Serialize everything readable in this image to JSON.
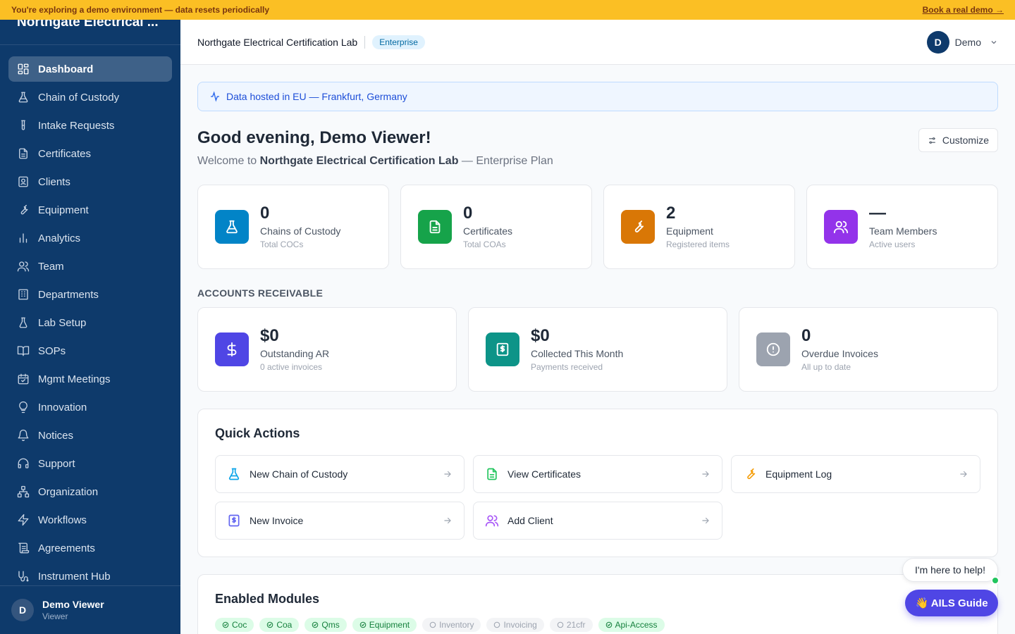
{
  "banner": {
    "text": "You're exploring a demo environment — data resets periodically",
    "link": "Book a real demo →"
  },
  "sidebar": {
    "brand": "Northgate Electrical ...",
    "items": [
      {
        "label": "Dashboard",
        "icon": "dashboard-icon",
        "active": true
      },
      {
        "label": "Chain of Custody",
        "icon": "flask-icon"
      },
      {
        "label": "Intake Requests",
        "icon": "test-tube-icon"
      },
      {
        "label": "Certificates",
        "icon": "document-icon"
      },
      {
        "label": "Clients",
        "icon": "contact-icon"
      },
      {
        "label": "Equipment",
        "icon": "wrench-icon"
      },
      {
        "label": "Analytics",
        "icon": "bar-chart-icon"
      },
      {
        "label": "Team",
        "icon": "users-icon"
      },
      {
        "label": "Departments",
        "icon": "building-icon"
      },
      {
        "label": "Lab Setup",
        "icon": "beaker-icon"
      },
      {
        "label": "SOPs",
        "icon": "book-icon"
      },
      {
        "label": "Mgmt Meetings",
        "icon": "calendar-icon"
      },
      {
        "label": "Innovation",
        "icon": "lightbulb-icon"
      },
      {
        "label": "Notices",
        "icon": "bell-icon"
      },
      {
        "label": "Support",
        "icon": "headset-icon"
      },
      {
        "label": "Organization",
        "icon": "org-chart-icon"
      },
      {
        "label": "Workflows",
        "icon": "lightning-icon"
      },
      {
        "label": "Agreements",
        "icon": "scroll-icon"
      },
      {
        "label": "Instrument Hub",
        "icon": "instrument-icon"
      }
    ],
    "user": {
      "initial": "D",
      "name": "Demo Viewer",
      "role": "Viewer"
    }
  },
  "topbar": {
    "org": "Northgate Electrical Certification Lab",
    "plan": "Enterprise",
    "user_initial": "D",
    "user_name": "Demo"
  },
  "main": {
    "hosted": "Data hosted in EU — Frankfurt, Germany",
    "greeting": "Good evening, Demo Viewer!",
    "welcome_prefix": "Welcome to ",
    "welcome_org": "Northgate Electrical Certification Lab",
    "welcome_suffix": " — Enterprise Plan",
    "customize": "Customize",
    "stats": [
      {
        "value": "0",
        "label": "Chains of Custody",
        "sub": "Total COCs",
        "color": "#0284c7",
        "icon": "flask-icon"
      },
      {
        "value": "0",
        "label": "Certificates",
        "sub": "Total COAs",
        "color": "#16a34a",
        "icon": "document-icon"
      },
      {
        "value": "2",
        "label": "Equipment",
        "sub": "Registered items",
        "color": "#d97706",
        "icon": "wrench-icon"
      },
      {
        "value": "—",
        "label": "Team Members",
        "sub": "Active users",
        "color": "#9333ea",
        "icon": "users-icon"
      }
    ],
    "ar_title": "ACCOUNTS RECEIVABLE",
    "ar": [
      {
        "value": "$0",
        "label": "Outstanding AR",
        "sub": "0 active invoices",
        "color": "#4f46e5",
        "icon": "dollar-icon"
      },
      {
        "value": "$0",
        "label": "Collected This Month",
        "sub": "Payments received",
        "color": "#0d9488",
        "icon": "receipt-icon"
      },
      {
        "value": "0",
        "label": "Overdue Invoices",
        "sub": "All up to date",
        "color": "#9ca3af",
        "icon": "alert-circle-icon"
      }
    ],
    "quick_actions": {
      "title": "Quick Actions",
      "items": [
        {
          "label": "New Chain of Custody",
          "icon": "flask-icon",
          "color": "#0ea5e9"
        },
        {
          "label": "View Certificates",
          "icon": "document-icon",
          "color": "#22c55e"
        },
        {
          "label": "Equipment Log",
          "icon": "wrench-icon",
          "color": "#f59e0b"
        },
        {
          "label": "New Invoice",
          "icon": "receipt-icon",
          "color": "#6366f1"
        },
        {
          "label": "Add Client",
          "icon": "users-icon",
          "color": "#a855f7"
        }
      ]
    },
    "modules": {
      "title": "Enabled Modules",
      "chips": [
        {
          "label": "Coc",
          "on": true
        },
        {
          "label": "Coa",
          "on": true
        },
        {
          "label": "Qms",
          "on": true
        },
        {
          "label": "Equipment",
          "on": true
        },
        {
          "label": "Inventory",
          "on": false
        },
        {
          "label": "Invoicing",
          "on": false
        },
        {
          "label": "21cfr",
          "on": false
        },
        {
          "label": "Api-Access",
          "on": true
        }
      ]
    }
  },
  "helper": {
    "bubble": "I'm here to help!",
    "button": "👋 AILS Guide"
  }
}
